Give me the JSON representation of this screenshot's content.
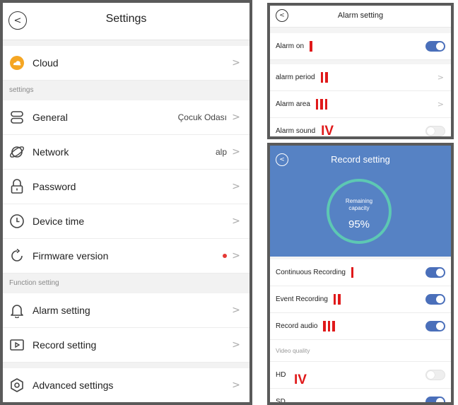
{
  "settings": {
    "back": "<",
    "title": "Settings",
    "cloud": {
      "label": "Cloud"
    },
    "section_settings": "settings",
    "general": {
      "label": "General",
      "value": "Çocuk Odası"
    },
    "network": {
      "label": "Network",
      "value": "alp"
    },
    "password": {
      "label": "Password"
    },
    "device_time": {
      "label": "Device time"
    },
    "firmware": {
      "label": "Firmware version"
    },
    "section_function": "Function setting",
    "alarm_setting": {
      "label": "Alarm setting"
    },
    "record_setting": {
      "label": "Record setting"
    },
    "advanced": {
      "label": "Advanced settings"
    },
    "chevron": ">"
  },
  "alarm": {
    "back": "<",
    "title": "Alarm setting",
    "rows": [
      {
        "label": "Alarm on",
        "marker": "I",
        "control": "toggle",
        "state": "on"
      },
      {
        "label": "alarm period",
        "marker": "II",
        "control": "chevron"
      },
      {
        "label": "Alarm area",
        "marker": "III",
        "control": "chevron"
      },
      {
        "label": "Alarm sound",
        "marker": "IV",
        "control": "toggle",
        "state": "off"
      }
    ],
    "chevron": ">"
  },
  "record": {
    "back": "<",
    "title": "Record setting",
    "remaining_line1": "Remaining",
    "remaining_line2": "capacity",
    "percent": "95%",
    "rows": [
      {
        "label": "Continuous Recording",
        "marker": "I",
        "state": "on"
      },
      {
        "label": "Event Recording",
        "marker": "II",
        "state": "on"
      },
      {
        "label": "Record audio",
        "marker": "III",
        "state": "on"
      }
    ],
    "video_quality_header": "Video quality",
    "hd": {
      "label": "HD",
      "state": "off"
    },
    "sd": {
      "label": "SD",
      "state": "on"
    },
    "sd_marker": "IV"
  },
  "colors": {
    "accent": "#4a6fba",
    "header_blue": "#5682c4",
    "ring": "#5dc8b3",
    "marker_red": "#e0191a",
    "dot_red": "#e53935",
    "cloud_orange": "#f5a623"
  },
  "icons": [
    "back-icon",
    "cloud-icon",
    "chevron-right-icon",
    "general-list-icon",
    "network-planet-icon",
    "lock-icon",
    "clock-icon",
    "refresh-icon",
    "bell-icon",
    "play-box-icon",
    "hexagon-gear-icon"
  ]
}
